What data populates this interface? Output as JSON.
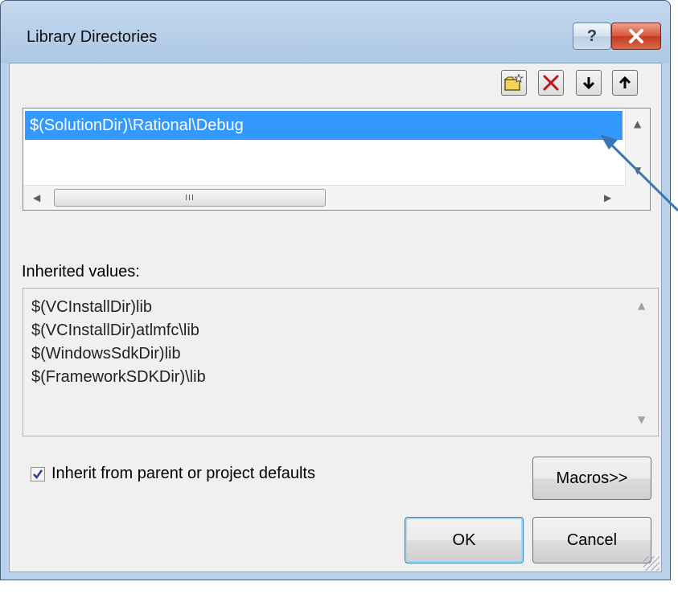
{
  "window": {
    "title": "Library Directories",
    "help_label": "?",
    "close_icon": "close-icon"
  },
  "toolbar": {
    "new_line_icon": "new-folder-icon",
    "delete_icon": "delete-icon",
    "move_down_icon": "arrow-down-icon",
    "move_up_icon": "arrow-up-icon"
  },
  "directories": [
    "$(SolutionDir)\\Rational\\Debug"
  ],
  "hscroll_grip": "III",
  "inherited": {
    "label": "Inherited values:",
    "values": [
      "$(VCInstallDir)lib",
      "$(VCInstallDir)atlmfc\\lib",
      "$(WindowsSdkDir)lib",
      "$(FrameworkSDKDir)\\lib"
    ]
  },
  "inherit_checkbox": {
    "label": "Inherit from parent or project defaults",
    "checked": true
  },
  "buttons": {
    "macros": "Macros>>",
    "ok": "OK",
    "cancel": "Cancel"
  },
  "colors": {
    "selection": "#3399ff",
    "close_red": "#c33b1e",
    "callout": "#3a75b5"
  }
}
